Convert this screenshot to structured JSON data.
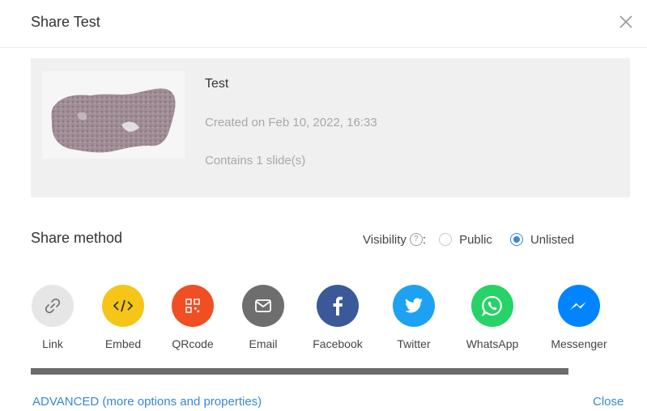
{
  "dialog": {
    "title": "Share Test"
  },
  "item": {
    "name": "Test",
    "created": "Created on Feb 10, 2022, 16:33",
    "contains": "Contains 1 slide(s)"
  },
  "share": {
    "heading": "Share method",
    "visibility_label": "Visibility",
    "visibility_colon": ":",
    "options": [
      {
        "label": "Public",
        "selected": false
      },
      {
        "label": "Unlisted",
        "selected": true
      }
    ],
    "methods": [
      {
        "label": "Link",
        "icon": "link-icon",
        "color": "#e6e6e6"
      },
      {
        "label": "Embed",
        "icon": "code-icon",
        "color": "#f5c518"
      },
      {
        "label": "QRcode",
        "icon": "qrcode-icon",
        "color": "#f04e23"
      },
      {
        "label": "Email",
        "icon": "mail-icon",
        "color": "#6e6e6e"
      },
      {
        "label": "Facebook",
        "icon": "facebook-icon",
        "color": "#3b5998"
      },
      {
        "label": "Twitter",
        "icon": "twitter-icon",
        "color": "#1da1f2"
      },
      {
        "label": "WhatsApp",
        "icon": "whatsapp-icon",
        "color": "#25d366"
      },
      {
        "label": "Messenger",
        "icon": "messenger-icon",
        "color": "#0084ff"
      }
    ]
  },
  "footer": {
    "advanced_label": "ADVANCED (more options and properties)",
    "close_label": "Close"
  },
  "colors": {
    "accent": "#3a86d8"
  }
}
